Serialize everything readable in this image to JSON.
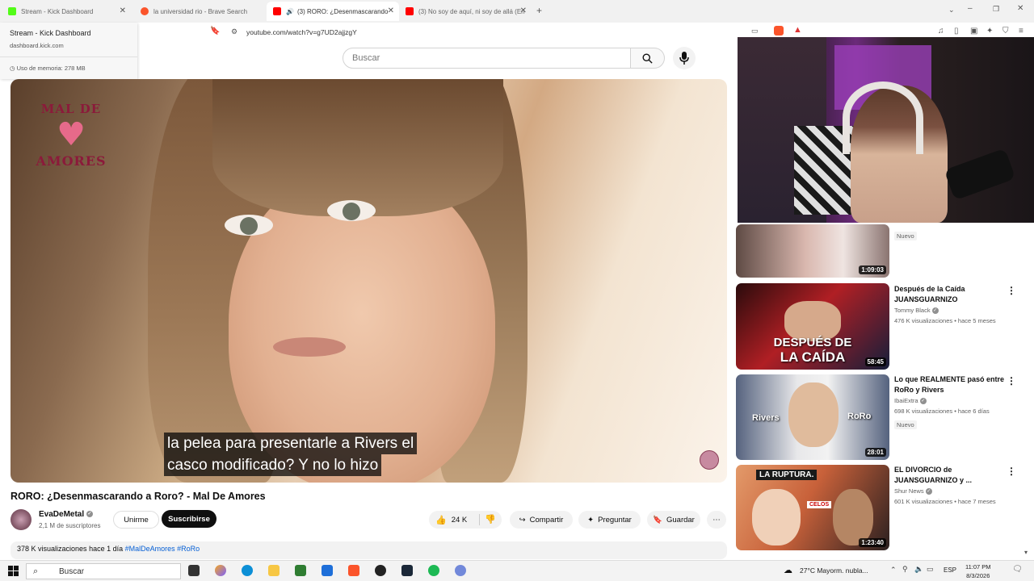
{
  "browser": {
    "tabs": [
      {
        "label": "Stream - Kick Dashboard",
        "favicon_color": "#53fc18",
        "active": false
      },
      {
        "label": "la universidad rio - Brave Search",
        "favicon_color": "#fb542b",
        "active": false
      },
      {
        "label": "(3) RORO: ¿Desenmascarando",
        "favicon_color": "#ff0000",
        "active": true
      },
      {
        "label": "(3) No soy de aquí, ni soy de allá (En",
        "favicon_color": "#ff0000",
        "active": false
      }
    ],
    "url": "youtube.com/watch?v=g7UD2ajjzgY",
    "hover_card": {
      "title": "Stream - Kick Dashboard",
      "domain": "dashboard.kick.com",
      "memory": "Uso de memoria: 278 MB"
    }
  },
  "youtube": {
    "search_placeholder": "Buscar",
    "video": {
      "logo_line1": "MAL DE",
      "logo_line2": "AMORES",
      "subtitle_line1": "la pelea para presentarle a Rivers el",
      "subtitle_line2": "casco modificado? Y no lo hizo",
      "title": "RORO: ¿Desenmascarando a Roro? - Mal De Amores"
    },
    "channel": {
      "name": "EvaDeMetal",
      "subscribers": "2,1 M de suscriptores",
      "join_label": "Unirme",
      "subscribe_label": "Suscribirse"
    },
    "actions": {
      "likes": "24 K",
      "share": "Compartir",
      "ask": "Preguntar",
      "save": "Guardar"
    },
    "description": {
      "views": "378 K visualizaciones",
      "date": "hace 1 día",
      "tags": "#MalDeAmores #RoRo"
    },
    "sidebar": [
      {
        "title": "",
        "channel": "",
        "meta": "",
        "badge": "Nuevo",
        "duration": "1:09:03",
        "thumb_color": "#c9a39b"
      },
      {
        "title": "Después de la Caída JUANSGUARNIZO",
        "channel": "Tommy Black",
        "meta": "476 K visualizaciones • hace 5 meses",
        "badge": "",
        "duration": "58:45",
        "thumb_color": "#b01f24",
        "overlay1": "DESPUÉS DE",
        "overlay2": "LA CAÍDA"
      },
      {
        "title": "Lo que REALMENTE pasó entre RoRo y Rivers",
        "channel": "IbaiExtra",
        "meta": "698 K visualizaciones • hace 6 días",
        "badge": "Nuevo",
        "duration": "28:01",
        "thumb_color": "#7c8aa4",
        "overlay1": "Rivers",
        "overlay2": "RoRo"
      },
      {
        "title": "EL DIVORCIO de JUANSGUARNIZO y ...",
        "channel": "Shur News",
        "meta": "601 K visualizaciones • hace 7 meses",
        "badge": "",
        "duration": "1:23:40",
        "thumb_color": "#c8613a",
        "overlay1": "LA RUPTURA.",
        "overlay2": "CELOS"
      }
    ]
  },
  "taskbar": {
    "search": "Buscar",
    "weather": "27°C  Mayorm. nubla...",
    "lang": "ESP",
    "time": "11:07 PM",
    "date": "8/3/2026"
  }
}
